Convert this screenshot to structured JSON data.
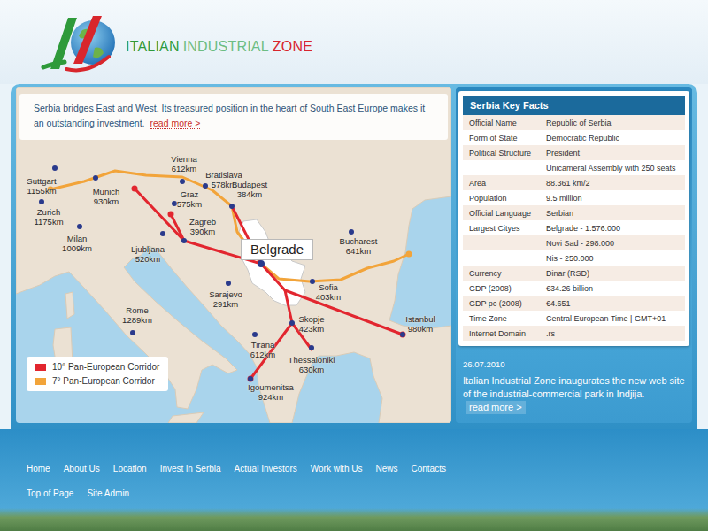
{
  "header": {
    "logo": {
      "words": [
        {
          "text": "ITALIAN",
          "color": "#2e9a3a"
        },
        {
          "text": "INDUSTRIAL",
          "color": "#6dbd83"
        },
        {
          "text": "ZONE",
          "color": "#d8262c"
        }
      ]
    }
  },
  "intro": {
    "text": "Serbia bridges East and West. Its treasured position in the heart of South East Europe makes it an outstanding investment.",
    "link": "read more >"
  },
  "map": {
    "capital": "Belgrade",
    "cities": [
      {
        "name": "Suttgart",
        "distance": "1155km"
      },
      {
        "name": "Zurich",
        "distance": "1175km"
      },
      {
        "name": "Munich",
        "distance": "930km"
      },
      {
        "name": "Milan",
        "distance": "1009km"
      },
      {
        "name": "Vienna",
        "distance": "612km"
      },
      {
        "name": "Bratislava",
        "distance": "578km"
      },
      {
        "name": "Budapest",
        "distance": "384km"
      },
      {
        "name": "Graz",
        "distance": "575km"
      },
      {
        "name": "Zagreb",
        "distance": "390km"
      },
      {
        "name": "Ljubljana",
        "distance": "520km"
      },
      {
        "name": "Sarajevo",
        "distance": "291km"
      },
      {
        "name": "Bucharest",
        "distance": "641km"
      },
      {
        "name": "Sofia",
        "distance": "403km"
      },
      {
        "name": "Skopje",
        "distance": "423km"
      },
      {
        "name": "Tirana",
        "distance": "612km"
      },
      {
        "name": "Thessaloniki",
        "distance": "630km"
      },
      {
        "name": "Istanbul",
        "distance": "980km"
      },
      {
        "name": "Rome",
        "distance": "1289km"
      },
      {
        "name": "Igoumenitsa",
        "distance": "924km"
      }
    ],
    "legend": [
      {
        "label": "10° Pan-European Corridor",
        "color": "#e2262f"
      },
      {
        "label": "7° Pan-European Corridor",
        "color": "#f2a43a"
      }
    ]
  },
  "key_facts": {
    "title": "Serbia Key Facts",
    "rows": [
      {
        "label": "Official Name",
        "value": "Republic of Serbia"
      },
      {
        "label": "Form of State",
        "value": "Democratic Republic"
      },
      {
        "label": "Political Structure",
        "value": "President"
      },
      {
        "label": "",
        "value": "Unicameral Assembly with 250 seats"
      },
      {
        "label": "Area",
        "value": "88.361 km/2"
      },
      {
        "label": "Population",
        "value": "9.5 million"
      },
      {
        "label": "Official Language",
        "value": "Serbian"
      },
      {
        "label": "Largest Cityes",
        "value": "Belgrade - 1.576.000"
      },
      {
        "label": "",
        "value": "Novi Sad - 298.000"
      },
      {
        "label": "",
        "value": "Nis - 250.000"
      },
      {
        "label": "Currency",
        "value": "Dinar (RSD)"
      },
      {
        "label": "GDP (2008)",
        "value": "€34.26 billion"
      },
      {
        "label": "GDP pc (2008)",
        "value": "€4.651"
      },
      {
        "label": "Time Zone",
        "value": "Central European Time | GMT+01"
      },
      {
        "label": "Internet Domain",
        "value": ".rs"
      }
    ]
  },
  "news": {
    "date": "26.07.2010",
    "text": "Italian Industrial Zone inaugurates the new web site of the industrial-commercial park in Indjija.",
    "link": "read more >"
  },
  "nav": {
    "items": [
      "Home",
      "About Us",
      "Location",
      "Invest in Serbia",
      "Actual Investors",
      "Work with Us",
      "News",
      "Contacts"
    ],
    "secondary": [
      "Top of Page",
      "Site Admin"
    ]
  }
}
